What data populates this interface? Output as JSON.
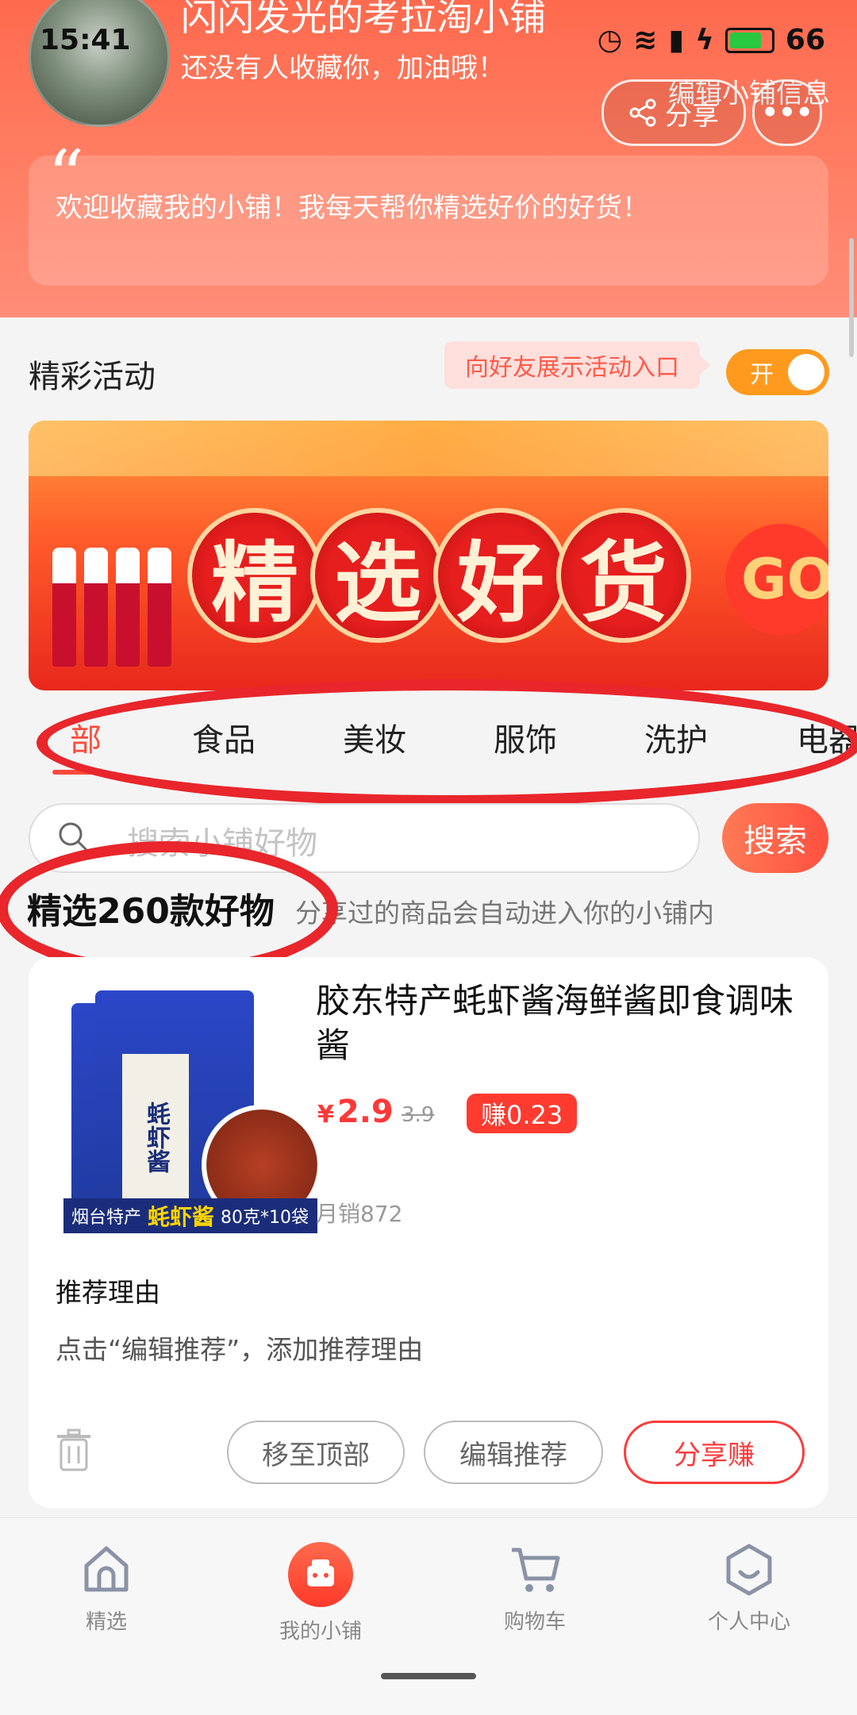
{
  "status_bar": {
    "time": "15:41",
    "battery": "66"
  },
  "header": {
    "shop_name": "闪闪发光的考拉淘小铺",
    "subtitle": "还没有人收藏你，加油哦！",
    "edit_info_label": "编辑小铺信息",
    "share_label": "分享",
    "more_label": "•••",
    "welcome_text": "欢迎收藏我的小铺！我每天帮你精选好价的好货！"
  },
  "activity": {
    "title": "精彩活动",
    "tip": "向好友展示活动入口",
    "toggle_label": "开",
    "banner_chars": [
      "精",
      "选",
      "好",
      "货"
    ],
    "banner_go": "GO"
  },
  "tabs": [
    {
      "label": "部",
      "active": true
    },
    {
      "label": "食品"
    },
    {
      "label": "美妆"
    },
    {
      "label": "服饰"
    },
    {
      "label": "洗护"
    },
    {
      "label": "电器"
    }
  ],
  "search": {
    "placeholder": "搜索小铺好物",
    "button": "搜索"
  },
  "summary": {
    "count_label": "精选260款好物",
    "hint": "分享过的商品会自动进入你的小铺内"
  },
  "product": {
    "image": {
      "label_vertical": "蚝虾酱",
      "strip_left": "烟台特产",
      "strip_bold": "蚝虾酱",
      "strip_right": "80克*10袋"
    },
    "title": "胶东特产蚝虾酱海鲜酱即食调味酱",
    "currency": "¥",
    "price": "2.9",
    "original_price": "3.9",
    "earn_badge": "赚0.23",
    "monthly_sales": "月销872",
    "reason_title": "推荐理由",
    "reason_text": "点击“编辑推荐”，添加推荐理由",
    "btn_top": "移至顶部",
    "btn_edit": "编辑推荐",
    "btn_share": "分享赚"
  },
  "bottom_nav": [
    {
      "label": "精选"
    },
    {
      "label": "我的小铺",
      "active": true
    },
    {
      "label": "购物车"
    },
    {
      "label": "个人中心"
    }
  ],
  "colors": {
    "accent": "#ff4a3a",
    "header": "#ff6a4e",
    "toggle": "#ff9a1e",
    "annotation": "#e8262b"
  }
}
